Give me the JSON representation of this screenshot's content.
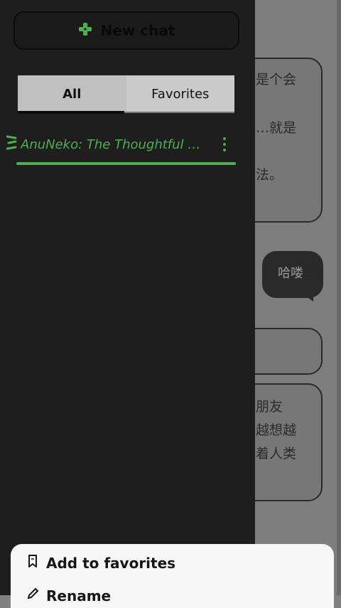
{
  "background_chat": {
    "top_text": "",
    "bubble_1_lines": [
      "是个会",
      "…就是",
      "法。"
    ],
    "bubble_2_text": "哈喽",
    "bubble_4_lines": [
      "朋友",
      "越想越",
      "着人类"
    ]
  },
  "drawer": {
    "new_chat_label": "New chat",
    "tabs": [
      {
        "label": "All",
        "active": true
      },
      {
        "label": "Favorites",
        "active": false
      }
    ],
    "chats": [
      {
        "title": "AnuNeko: The Thoughtful Cat"
      }
    ]
  },
  "bottom_sheet": {
    "items": [
      {
        "label": "Add to favorites",
        "icon": "bookmark-icon"
      },
      {
        "label": "Rename",
        "icon": "edit-icon"
      }
    ]
  },
  "colors": {
    "accent": "#4caf50",
    "drawer_bg": "#1e1e1e",
    "sheet_bg": "#f7f7f7"
  }
}
